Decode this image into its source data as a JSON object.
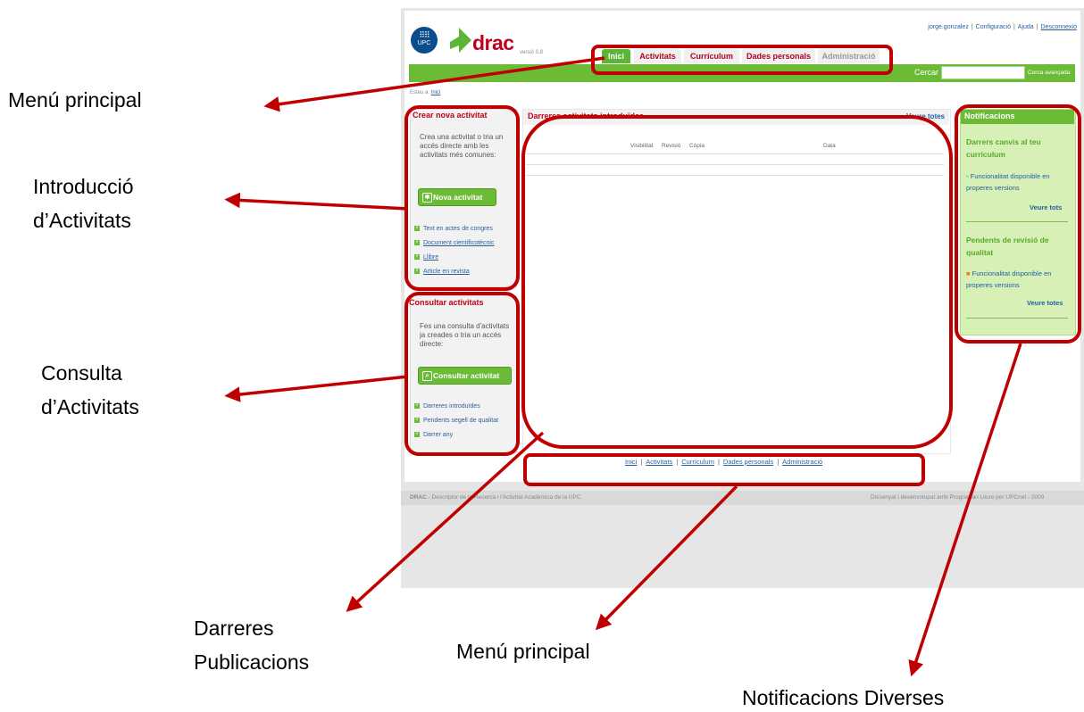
{
  "header": {
    "version": "versió 0.8",
    "upc": "UPC",
    "logo_text": "drac",
    "top_links": [
      "jorge.gonzalez",
      "Configuració",
      "Ajuda",
      "Desconnexió"
    ]
  },
  "tabs": [
    "Inici",
    "Activitats",
    "Currículum",
    "Dades personals",
    "Administració"
  ],
  "search": {
    "label": "Cercar",
    "value": "",
    "advanced": "Cerca avançada"
  },
  "breadcrumb": {
    "prefix": "Esteu a:",
    "link": "Inici"
  },
  "crear": {
    "title": "Crear nova activitat",
    "text": "Crea una activitat o tria un accés directe amb les activitats més comunes:",
    "button": "Nova activitat",
    "links": [
      "Text en actes de congres",
      "Document cientificotècnic",
      "Llibre",
      "Article en revista"
    ]
  },
  "consultar": {
    "title": "Consultar activitats",
    "text": "Fes una consulta d'activitats ja creades o tria un accés directe:",
    "button": "Consultar activitat",
    "links": [
      "Darreres introduïdes",
      "Pendents segell de qualitat",
      "Darrer any"
    ]
  },
  "center": {
    "title": "Darreres activitats introduïdes",
    "see_all": "Veure totes",
    "columns": [
      "Visibilitat",
      "Revisió",
      "Còpia",
      "Data"
    ]
  },
  "notifications": {
    "title": "Notificacions",
    "sections": [
      {
        "heading": "Darrers canvis al teu currículum",
        "item": "Funcionalitat disponible en properes versions",
        "link": "Veure tots"
      },
      {
        "heading": "Pendents de revisió de qualitat",
        "item": "Funcionalitat disponible en properes versions",
        "link": "Veure totes"
      }
    ]
  },
  "footer": {
    "links": [
      "Inici",
      "Activitats",
      "Currículum",
      "Dades personals",
      "Administració"
    ],
    "brand": "DRAC",
    "left": " - Descriptor de la Recerca i l'Activitat Acadèmica de la UPC",
    "right": "Dissenyat i desenvolupat amb Programari Lliure per UPCnet - 2009"
  },
  "annotations": {
    "menu_top": "Menú principal",
    "intro_1": "Introducció",
    "intro_2": "d’Activitats",
    "consulta_1": "Consulta",
    "consulta_2": "d’Activitats",
    "darreres_1": "Darreres",
    "darreres_2": "Publicacions",
    "menu_bottom": "Menú principal",
    "notif": "Notificacions Diverses"
  },
  "colors": {
    "annotation": "#c00000",
    "green": "#6cbb37",
    "red_text": "#c00018"
  }
}
